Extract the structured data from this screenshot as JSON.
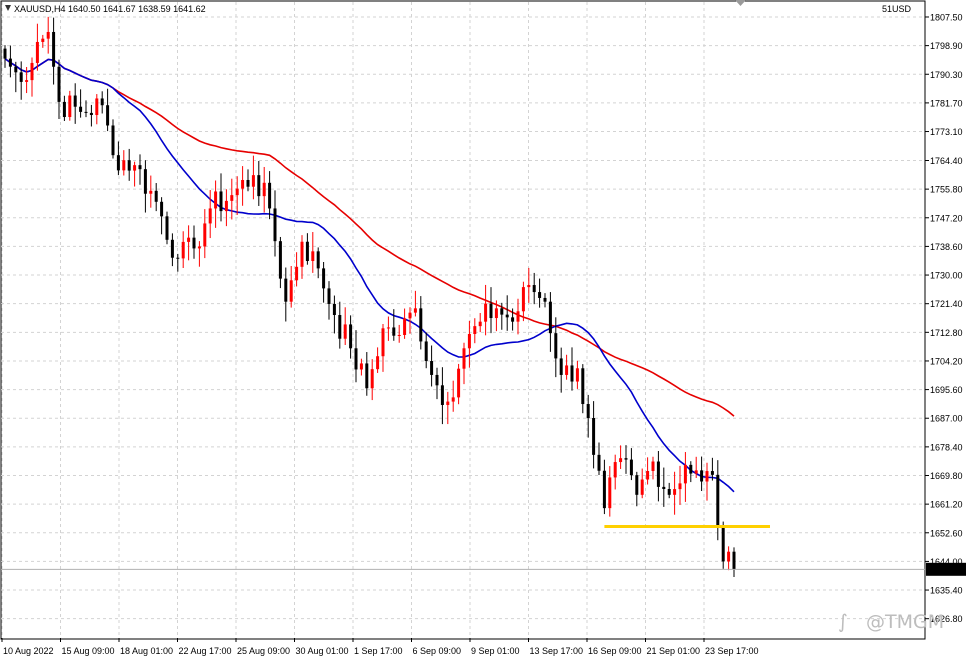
{
  "window": {
    "symbol_header": "XAUUSD,H4  1640.50 1641.67 1638.59 1641.62",
    "indicator_label": "51USD",
    "last_price_label": "1641.62",
    "watermark": "@TMGM"
  },
  "colors": {
    "bull": "#ff0000",
    "bear": "#000000",
    "ma_fast": "#0000cc",
    "ma_slow": "#e60000",
    "support_line": "#ffd000",
    "grid": "#d3d3d3",
    "price_tag_bg": "#000000",
    "price_tag_text": "#ffffff"
  },
  "chart_data": {
    "type": "candlestick",
    "symbol": "XAUUSD",
    "timeframe": "H4",
    "ylim": [
      1621.0,
      1812.0
    ],
    "grid": true,
    "x_tick_labels": [
      "10 Aug 2022",
      "15 Aug 09:00",
      "18 Aug 01:00",
      "22 Aug 17:00",
      "25 Aug 09:00",
      "30 Aug 01:00",
      "1 Sep 17:00",
      "6 Sep 09:00",
      "9 Sep 01:00",
      "13 Sep 17:00",
      "16 Sep 09:00",
      "21 Sep 01:00",
      "23 Sep 17:00"
    ],
    "y_ticks": [
      1807.5,
      1798.9,
      1790.3,
      1781.7,
      1773.1,
      1764.4,
      1755.8,
      1747.2,
      1738.6,
      1730.0,
      1721.4,
      1712.8,
      1704.2,
      1695.6,
      1687.0,
      1678.4,
      1669.8,
      1661.2,
      1652.6,
      1644.0,
      1635.4,
      1626.8
    ],
    "y_tick_labels": [
      "1807.50",
      "1798.90",
      "1790.30",
      "1781.70",
      "1773.10",
      "1764.40",
      "1755.80",
      "1747.20",
      "1738.60",
      "1730.00",
      "1721.40",
      "1712.80",
      "1704.20",
      "1695.60",
      "1687.00",
      "1678.40",
      "1669.80",
      "1661.20",
      "1652.60",
      "1644.00",
      "1635.40",
      "1626.80"
    ],
    "last_price": 1641.62,
    "support_level": 1654.5,
    "support_from_index": 111,
    "close_waypoints": [
      [
        0,
        1795
      ],
      [
        3,
        1788
      ],
      [
        6,
        1800
      ],
      [
        8,
        1803
      ],
      [
        10,
        1782
      ],
      [
        14,
        1779
      ],
      [
        18,
        1781
      ],
      [
        20,
        1766
      ],
      [
        24,
        1763
      ],
      [
        28,
        1752
      ],
      [
        32,
        1735
      ],
      [
        35,
        1738
      ],
      [
        38,
        1750
      ],
      [
        42,
        1754
      ],
      [
        46,
        1760
      ],
      [
        49,
        1750
      ],
      [
        52,
        1722
      ],
      [
        55,
        1740
      ],
      [
        58,
        1732
      ],
      [
        61,
        1718
      ],
      [
        64,
        1708
      ],
      [
        67,
        1696
      ],
      [
        70,
        1714
      ],
      [
        73,
        1712
      ],
      [
        76,
        1720
      ],
      [
        79,
        1700
      ],
      [
        82,
        1692
      ],
      [
        85,
        1708
      ],
      [
        88,
        1716
      ],
      [
        91,
        1720
      ],
      [
        94,
        1716
      ],
      [
        97,
        1727
      ],
      [
        100,
        1722
      ],
      [
        103,
        1700
      ],
      [
        106,
        1702
      ],
      [
        109,
        1676
      ],
      [
        111,
        1660
      ],
      [
        114,
        1675
      ],
      [
        117,
        1664
      ],
      [
        120,
        1674
      ],
      [
        123,
        1664
      ],
      [
        126,
        1673
      ],
      [
        129,
        1668
      ],
      [
        131,
        1670
      ],
      [
        133,
        1644
      ],
      [
        135,
        1641.62
      ]
    ],
    "series": [
      {
        "name": "MA fast",
        "type": "line",
        "period": 21
      },
      {
        "name": "MA slow",
        "type": "line",
        "period": 50
      }
    ]
  }
}
